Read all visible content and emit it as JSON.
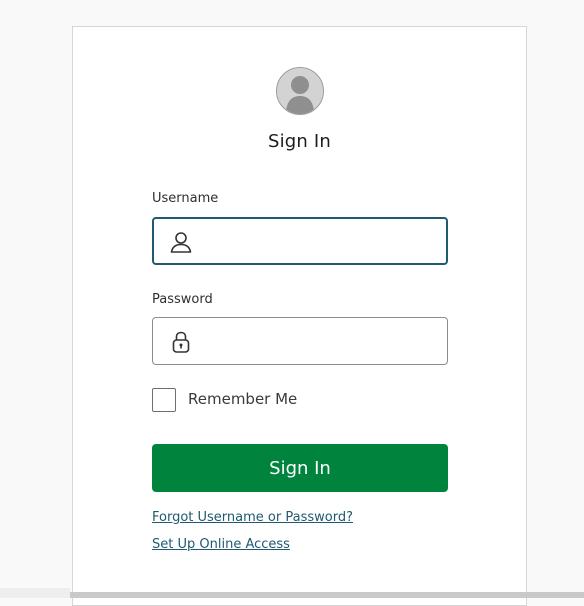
{
  "header": {
    "title": "Sign In"
  },
  "icons": {
    "avatar": "user-avatar-icon",
    "username": "person-icon",
    "password": "lock-icon"
  },
  "username": {
    "label": "Username",
    "value": "",
    "placeholder": ""
  },
  "password": {
    "label": "Password",
    "value": "",
    "placeholder": ""
  },
  "remember": {
    "label": "Remember Me",
    "checked": false
  },
  "actions": {
    "signin_label": "Sign In"
  },
  "links": {
    "forgot": "Forgot Username or Password?",
    "setup": "Set Up Online Access"
  },
  "colors": {
    "primary_button": "#00843d",
    "focus_border": "#1e5a70",
    "link": "#1e5a70"
  }
}
